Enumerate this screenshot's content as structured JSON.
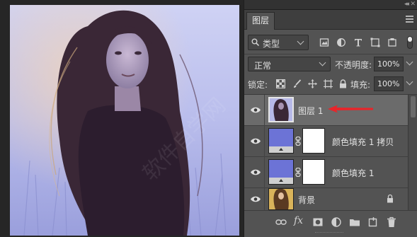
{
  "panel": {
    "tab_label": "图层",
    "filter": {
      "label": "类型"
    },
    "blend_mode": "正常",
    "opacity_label": "不透明度:",
    "opacity_value": "100%",
    "lock_label": "锁定:",
    "fill_label": "填充:",
    "fill_value": "100%"
  },
  "layers": [
    {
      "name": "图层 1",
      "selected": true
    },
    {
      "name": "颜色填充 1 拷贝",
      "selected": false
    },
    {
      "name": "颜色填充 1",
      "selected": false
    },
    {
      "name": "背景",
      "selected": false,
      "locked": true
    }
  ],
  "colors": {
    "fill_color": "#6c73d6",
    "arrow": "#e8252a",
    "panel_bg": "#535353",
    "selected_row": "#6b6b6b"
  },
  "footer": {
    "fx_label": "fx"
  }
}
